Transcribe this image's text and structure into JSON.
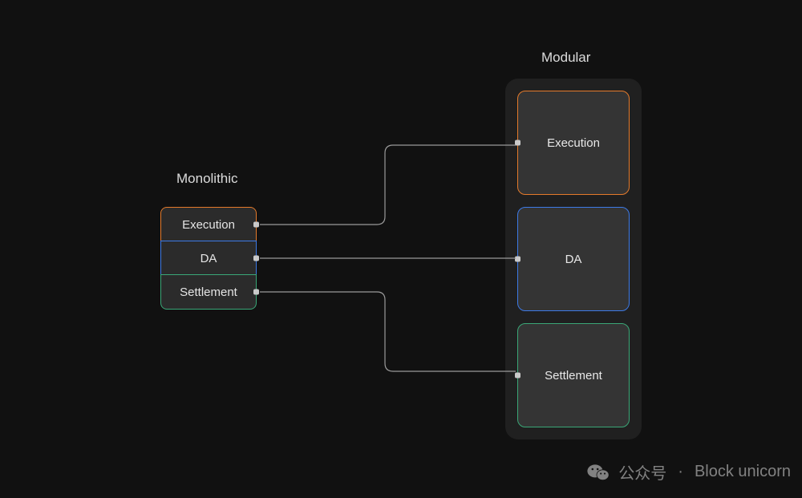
{
  "headings": {
    "monolithic": "Monolithic",
    "modular": "Modular"
  },
  "monolithic": {
    "layers": [
      {
        "label": "Execution",
        "color": "#e47a2b"
      },
      {
        "label": "DA",
        "color": "#3d7ae6"
      },
      {
        "label": "Settlement",
        "color": "#3aa777"
      }
    ]
  },
  "modular": {
    "layers": [
      {
        "label": "Execution",
        "color": "#e47a2b"
      },
      {
        "label": "DA",
        "color": "#3d7ae6"
      },
      {
        "label": "Settlement",
        "color": "#3aa777"
      }
    ]
  },
  "watermark": {
    "label_prefix": "公众号",
    "separator": "·",
    "name": "Block unicorn"
  }
}
